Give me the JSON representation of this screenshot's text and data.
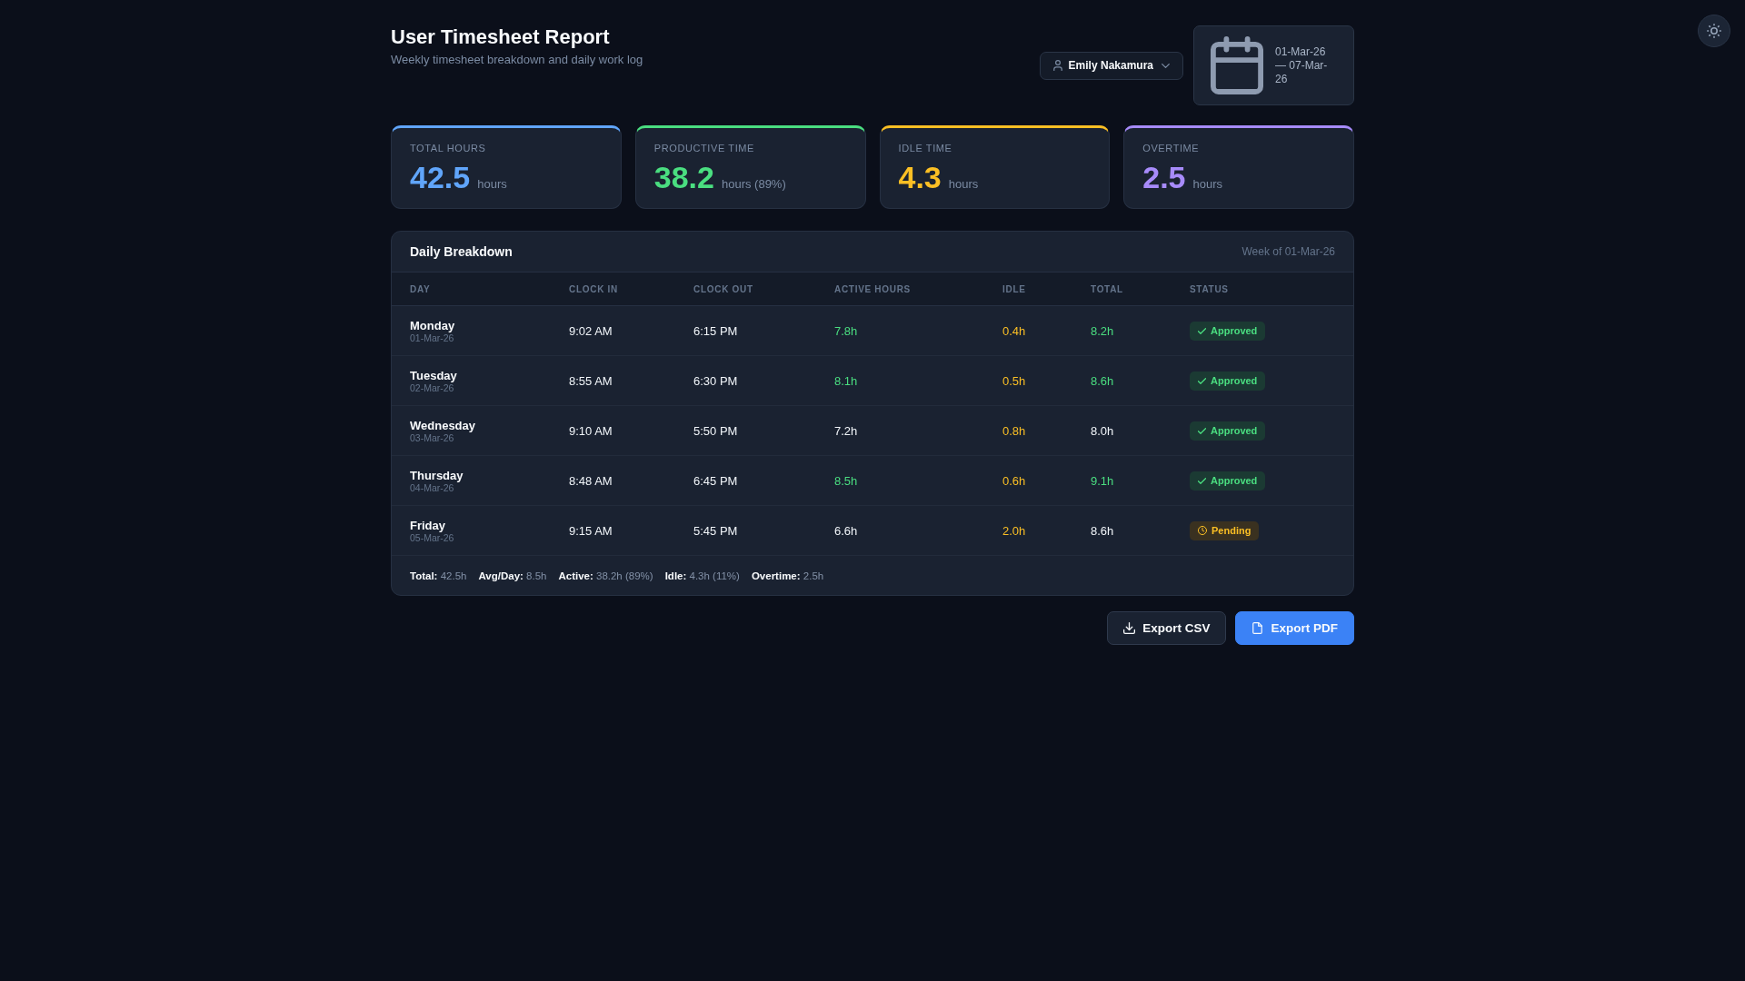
{
  "header": {
    "title": "User Timesheet Report",
    "subtitle": "Weekly timesheet breakdown and daily work log"
  },
  "user_select": {
    "value": "Emily Nakamura"
  },
  "date_range": {
    "text": "01-Mar-26 — 07-Mar-26"
  },
  "stats": [
    {
      "label": "TOTAL HOURS",
      "value": "42.5",
      "unit": "hours",
      "color": "#60a5fa"
    },
    {
      "label": "PRODUCTIVE TIME",
      "value": "38.2",
      "unit": "hours (89%)",
      "color": "#4ade80"
    },
    {
      "label": "IDLE TIME",
      "value": "4.3",
      "unit": "hours",
      "color": "#fbbf24"
    },
    {
      "label": "OVERTIME",
      "value": "2.5",
      "unit": "hours",
      "color": "#a78bfa"
    }
  ],
  "breakdown": {
    "title": "Daily Breakdown",
    "week": "Week of 01-Mar-26",
    "columns": [
      "DAY",
      "CLOCK IN",
      "CLOCK OUT",
      "ACTIVE HOURS",
      "IDLE",
      "TOTAL",
      "STATUS"
    ],
    "rows": [
      {
        "day": "Monday",
        "date": "01-Mar-26",
        "clock_in": "9:02 AM",
        "clock_out": "6:15 PM",
        "active": {
          "text": "7.8h",
          "color": "#4ade80"
        },
        "idle": {
          "text": "0.4h",
          "color": "#fbbf24"
        },
        "total": {
          "text": "8.2h",
          "color": "#4ade80"
        },
        "status": {
          "label": "Approved",
          "kind": "approved"
        }
      },
      {
        "day": "Tuesday",
        "date": "02-Mar-26",
        "clock_in": "8:55 AM",
        "clock_out": "6:30 PM",
        "active": {
          "text": "8.1h",
          "color": "#4ade80"
        },
        "idle": {
          "text": "0.5h",
          "color": "#fbbf24"
        },
        "total": {
          "text": "8.6h",
          "color": "#4ade80"
        },
        "status": {
          "label": "Approved",
          "kind": "approved"
        }
      },
      {
        "day": "Wednesday",
        "date": "03-Mar-26",
        "clock_in": "9:10 AM",
        "clock_out": "5:50 PM",
        "active": {
          "text": "7.2h",
          "color": "#f1f5f9"
        },
        "idle": {
          "text": "0.8h",
          "color": "#fbbf24"
        },
        "total": {
          "text": "8.0h",
          "color": "#f1f5f9"
        },
        "status": {
          "label": "Approved",
          "kind": "approved"
        }
      },
      {
        "day": "Thursday",
        "date": "04-Mar-26",
        "clock_in": "8:48 AM",
        "clock_out": "6:45 PM",
        "active": {
          "text": "8.5h",
          "color": "#4ade80"
        },
        "idle": {
          "text": "0.6h",
          "color": "#fbbf24"
        },
        "total": {
          "text": "9.1h",
          "color": "#4ade80"
        },
        "status": {
          "label": "Approved",
          "kind": "approved"
        }
      },
      {
        "day": "Friday",
        "date": "05-Mar-26",
        "clock_in": "9:15 AM",
        "clock_out": "5:45 PM",
        "active": {
          "text": "6.6h",
          "color": "#f1f5f9"
        },
        "idle": {
          "text": "2.0h",
          "color": "#fbbf24"
        },
        "total": {
          "text": "8.6h",
          "color": "#f1f5f9"
        },
        "status": {
          "label": "Pending",
          "kind": "pending"
        }
      }
    ],
    "summary": [
      "**Total:** 42.5h",
      "**Avg/Day:** 8.5h",
      "**Active:** 38.2h (89%)",
      "**Idle:** 4.3h (11%)",
      "**Overtime:** 2.5h"
    ]
  },
  "actions": [
    {
      "label": "Export CSV",
      "kind": "download",
      "primary": false
    },
    {
      "label": "Export PDF",
      "kind": "document",
      "primary": true
    }
  ]
}
